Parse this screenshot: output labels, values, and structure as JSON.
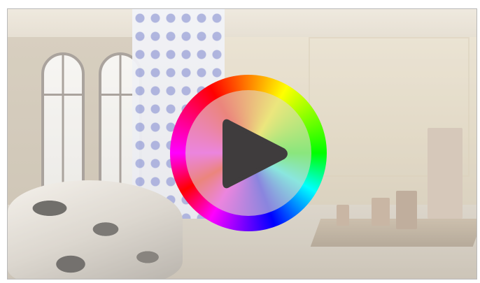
{
  "video": {
    "poster_description_icon": "gallery-scene",
    "play_icon": "play-icon",
    "colors": {
      "frame_border": "#b9b9b9",
      "play_glyph": "#3f3c3d",
      "ring": [
        "#ff00ff",
        "#ff0000",
        "#ffff00",
        "#00ff00",
        "#00ffff",
        "#0000ff"
      ]
    }
  }
}
